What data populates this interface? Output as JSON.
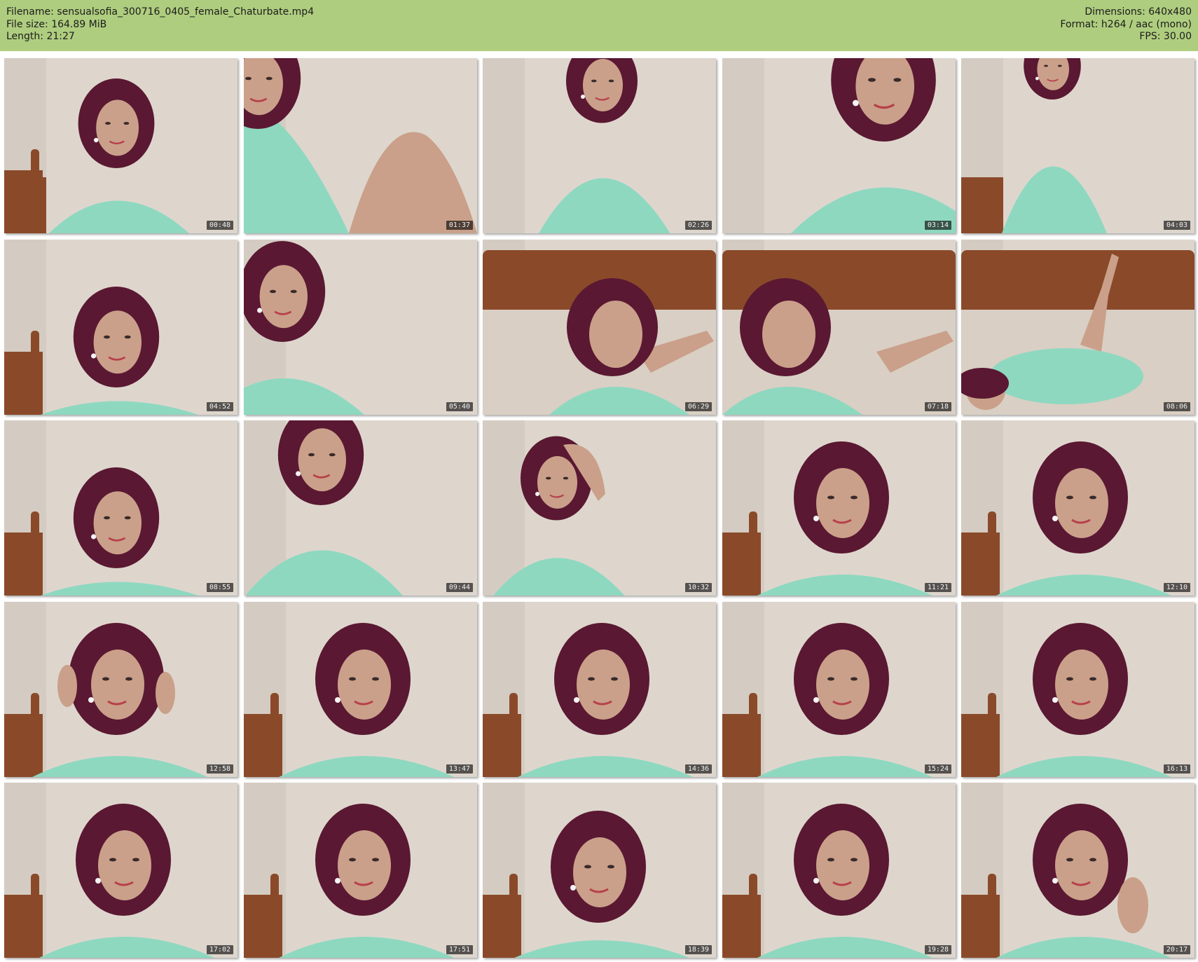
{
  "header": {
    "filename_line": "Filename: sensualsofia_300716_0405_female_Chaturbate.mp4",
    "filesize_line": "File size: 164.89 MiB",
    "length_line": "Length: 21:27",
    "dimensions_line": "Dimensions: 640x480",
    "format_line": "Format: h264 / aac (mono)",
    "fps_line": "FPS: 30.00"
  },
  "colors": {
    "header_bg": "#afcd7f",
    "wall": "#ded6cd",
    "shirt": "#8ed8c0",
    "hair": "#5a1832",
    "skin": "#caa08a",
    "bed_wood": "#8a4a2a",
    "sheet": "#d9cfc4"
  },
  "thumbnails": [
    {
      "time": "00:48",
      "scene": "sitting-bed"
    },
    {
      "time": "01:37",
      "scene": "closeup-legs"
    },
    {
      "time": "02:26",
      "scene": "standing"
    },
    {
      "time": "03:14",
      "scene": "leaning-closeup"
    },
    {
      "time": "04:03",
      "scene": "standing-torso"
    },
    {
      "time": "04:52",
      "scene": "portrait-low"
    },
    {
      "time": "05:40",
      "scene": "edge-portrait"
    },
    {
      "time": "06:29",
      "scene": "lying-bed"
    },
    {
      "time": "07:18",
      "scene": "lying-bed-side"
    },
    {
      "time": "08:06",
      "scene": "lying-legs-up"
    },
    {
      "time": "08:55",
      "scene": "portrait-low"
    },
    {
      "time": "09:44",
      "scene": "standing-side"
    },
    {
      "time": "10:32",
      "scene": "hand-hair"
    },
    {
      "time": "11:21",
      "scene": "portrait"
    },
    {
      "time": "12:10",
      "scene": "portrait"
    },
    {
      "time": "12:58",
      "scene": "hands-face"
    },
    {
      "time": "13:47",
      "scene": "portrait"
    },
    {
      "time": "14:36",
      "scene": "portrait"
    },
    {
      "time": "15:24",
      "scene": "portrait"
    },
    {
      "time": "16:13",
      "scene": "portrait"
    },
    {
      "time": "17:02",
      "scene": "portrait"
    },
    {
      "time": "17:51",
      "scene": "portrait"
    },
    {
      "time": "18:39",
      "scene": "portrait-tilt"
    },
    {
      "time": "19:28",
      "scene": "portrait"
    },
    {
      "time": "20:17",
      "scene": "portrait-hand"
    }
  ]
}
